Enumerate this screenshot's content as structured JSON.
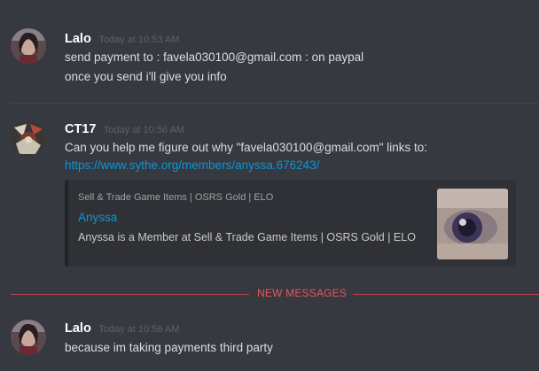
{
  "messages": [
    {
      "username": "Lalo",
      "timestamp": "Today at 10:53 AM",
      "lines": [
        "send payment to : favela030100@gmail.com : on paypal",
        "once you send i'll give you info"
      ]
    },
    {
      "username": "CT17",
      "timestamp": "Today at 10:56 AM",
      "lines": [
        "Can you help me figure out why \"favela030100@gmail.com\" links to:"
      ],
      "link": "https://www.sythe.org/members/anyssa.676243/",
      "embed": {
        "provider": "Sell & Trade Game Items | OSRS Gold | ELO",
        "title": "Anyssa",
        "description": "Anyssa is a Member at Sell & Trade Game Items | OSRS Gold | ELO"
      }
    },
    {
      "username": "Lalo",
      "timestamp": "Today at 10:56 AM",
      "lines": [
        "because im taking payments third party"
      ]
    }
  ],
  "new_messages_label": "NEW MESSAGES",
  "colors": {
    "background": "#36393f",
    "link": "#0a96d8",
    "new_messages": "#e05a5f"
  }
}
